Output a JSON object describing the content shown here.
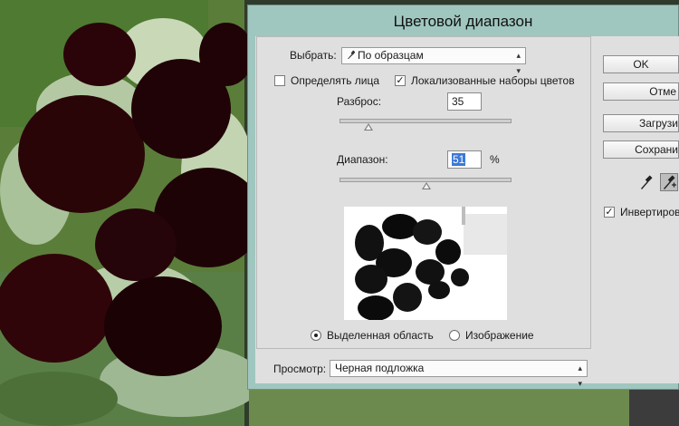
{
  "dialog": {
    "title": "Цветовой диапазон",
    "select_label": "Выбрать:",
    "select_value": "По образцам",
    "detect_faces_label": "Определять лица",
    "detect_faces_checked": false,
    "localized_label": "Локализованные наборы цветов",
    "localized_checked": true,
    "fuzziness_label": "Разброс:",
    "fuzziness_value": "35",
    "fuzziness_level": 0.17,
    "range_label": "Диапазон:",
    "range_value": "51",
    "range_unit": "%",
    "range_level": 0.51,
    "radio_selection_label": "Выделенная область",
    "radio_image_label": "Изображение",
    "selected_radio": "selection",
    "preview_label": "Просмотр:",
    "preview_value": "Черная подложка"
  },
  "buttons": {
    "ok": "OK",
    "cancel": "Отме",
    "load": "Загрузи",
    "save": "Сохрани",
    "invert_label": "Инвертиров",
    "invert_checked": true
  },
  "icons": {
    "select_dropdown": "eyedropper-icon",
    "eyedropper": "eyedropper-icon",
    "eyedropper_plus": "eyedropper-plus-icon"
  },
  "colors": {
    "title_bar": "#9fc7bf",
    "panel": "#dfdfdf",
    "range_highlight": "#3b78d8"
  }
}
